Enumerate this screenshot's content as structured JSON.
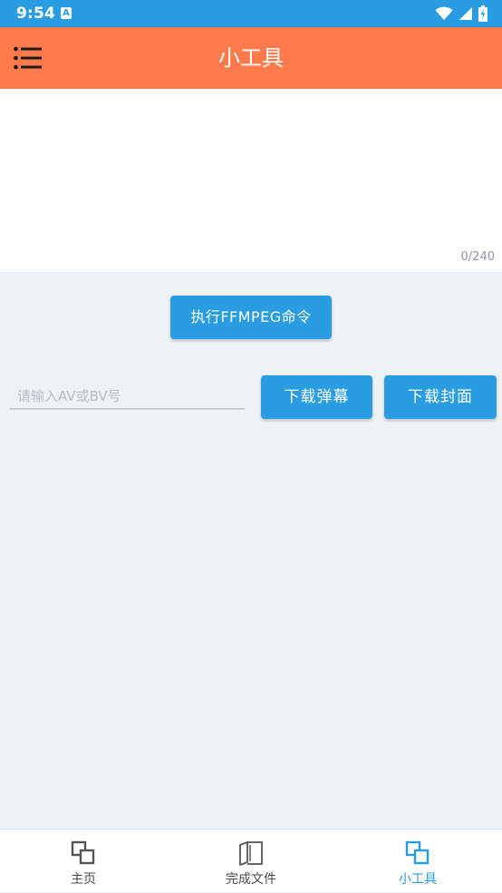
{
  "status_bar": {
    "time": "9:54",
    "a_icon_label": "A",
    "icons": [
      "a-notification-icon",
      "wifi-icon",
      "cellular-signal-icon",
      "battery-charging-icon"
    ]
  },
  "app_bar": {
    "title": "小工具",
    "menu_icon": "menu-list-icon",
    "background": "#ff7a4c"
  },
  "editor": {
    "value": "",
    "placeholder": "",
    "counter": "0/240"
  },
  "actions": {
    "ffmpeg_label": "执行FFMPEG命令",
    "danmaku_label": "下载弹幕",
    "cover_label": "下载封面"
  },
  "av_input": {
    "placeholder": "请输入AV或BV号",
    "value": ""
  },
  "bottom_nav": {
    "items": [
      {
        "label": "主页",
        "icon": "home-squares-icon",
        "active": false
      },
      {
        "label": "完成文件",
        "icon": "book-icon",
        "active": false
      },
      {
        "label": "小工具",
        "icon": "tools-squares-icon",
        "active": true
      }
    ]
  },
  "colors": {
    "status_bar": "#2a9de2",
    "accent": "#2a9de2",
    "app_bar": "#ff7a4c",
    "page_background": "#edf2f7"
  }
}
